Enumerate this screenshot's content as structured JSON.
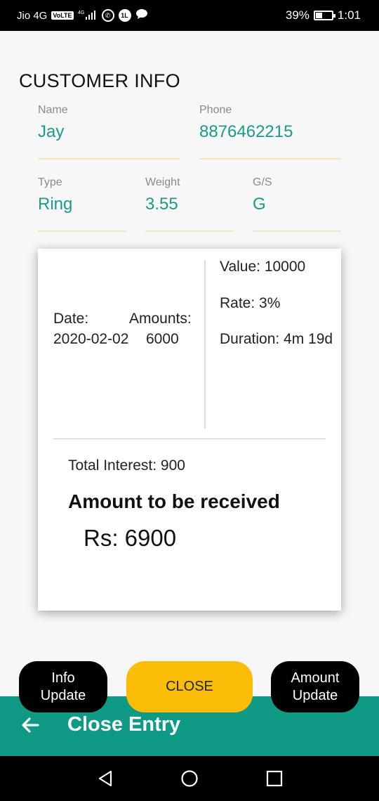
{
  "status_bar": {
    "carrier": "Jio 4G",
    "volte": "VoLTE",
    "network": "4G",
    "battery": "39%",
    "time": "1:01"
  },
  "section_title": "CUSTOMER INFO",
  "fields": {
    "name": {
      "label": "Name",
      "value": "Jay"
    },
    "phone": {
      "label": "Phone",
      "value": "8876462215"
    },
    "type": {
      "label": "Type",
      "value": "Ring"
    },
    "weight": {
      "label": "Weight",
      "value": "3.55"
    },
    "gs": {
      "label": "G/S",
      "value": "G"
    }
  },
  "card": {
    "date_label": "Date:",
    "amounts_label": "Amounts:",
    "date_value": "2020-02-02",
    "amount_value": "6000",
    "value_text": "Value: 10000",
    "rate_text": "Rate: 3%",
    "duration_text": "Duration: 4m 19d",
    "total_interest": "Total Interest: 900",
    "amount_heading": "Amount to be received",
    "amount_rs": "Rs: 6900"
  },
  "buttons": {
    "info_update_line1": "Info",
    "info_update_line2": "Update",
    "close": "CLOSE",
    "amount_update_line1": "Amount",
    "amount_update_line2": "Update"
  },
  "bottom_bar": {
    "title": "Close Entry"
  },
  "colors": {
    "accent_teal": "#0f9a86",
    "value_teal": "#1a9a8c",
    "close_yellow": "#fbbd08",
    "underline": "#f6e6b8"
  },
  "icons": {
    "back": "arrow-left-icon",
    "nav_back": "triangle-back-icon",
    "nav_home": "circle-home-icon",
    "nav_recents": "square-recents-icon"
  }
}
